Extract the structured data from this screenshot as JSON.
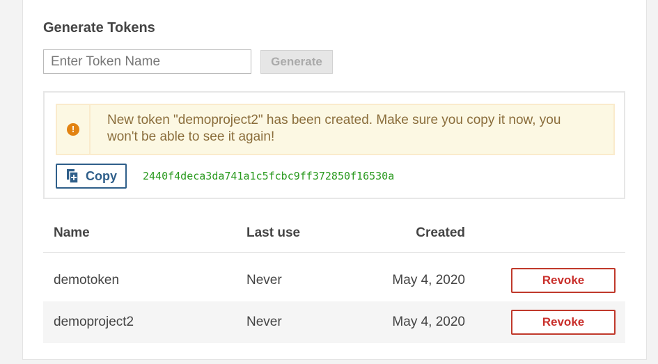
{
  "generate": {
    "title": "Generate Tokens",
    "input_placeholder": "Enter Token Name",
    "input_value": "",
    "generate_label": "Generate"
  },
  "new_token": {
    "alert_icon": "exclamation-circle-icon",
    "message": "New token \"demoproject2\" has been created. Make sure you copy it now, you won't be able to see it again!",
    "copy_icon": "copy-icon",
    "copy_label": "Copy",
    "token_value": "2440f4deca3da741a1c5fcbc9ff372850f16530a"
  },
  "table": {
    "columns": {
      "name": "Name",
      "last_use": "Last use",
      "created": "Created"
    },
    "rows": [
      {
        "name": "demotoken",
        "last_use": "Never",
        "created": "May 4, 2020",
        "action": "Revoke"
      },
      {
        "name": "demoproject2",
        "last_use": "Never",
        "created": "May 4, 2020",
        "action": "Revoke"
      }
    ]
  },
  "colors": {
    "warning_bg": "#fcf8e3",
    "warning_text": "#8a6d3b",
    "token_text": "#2a9a1f",
    "revoke": "#c9302c",
    "copy": "#2f5f8a"
  }
}
